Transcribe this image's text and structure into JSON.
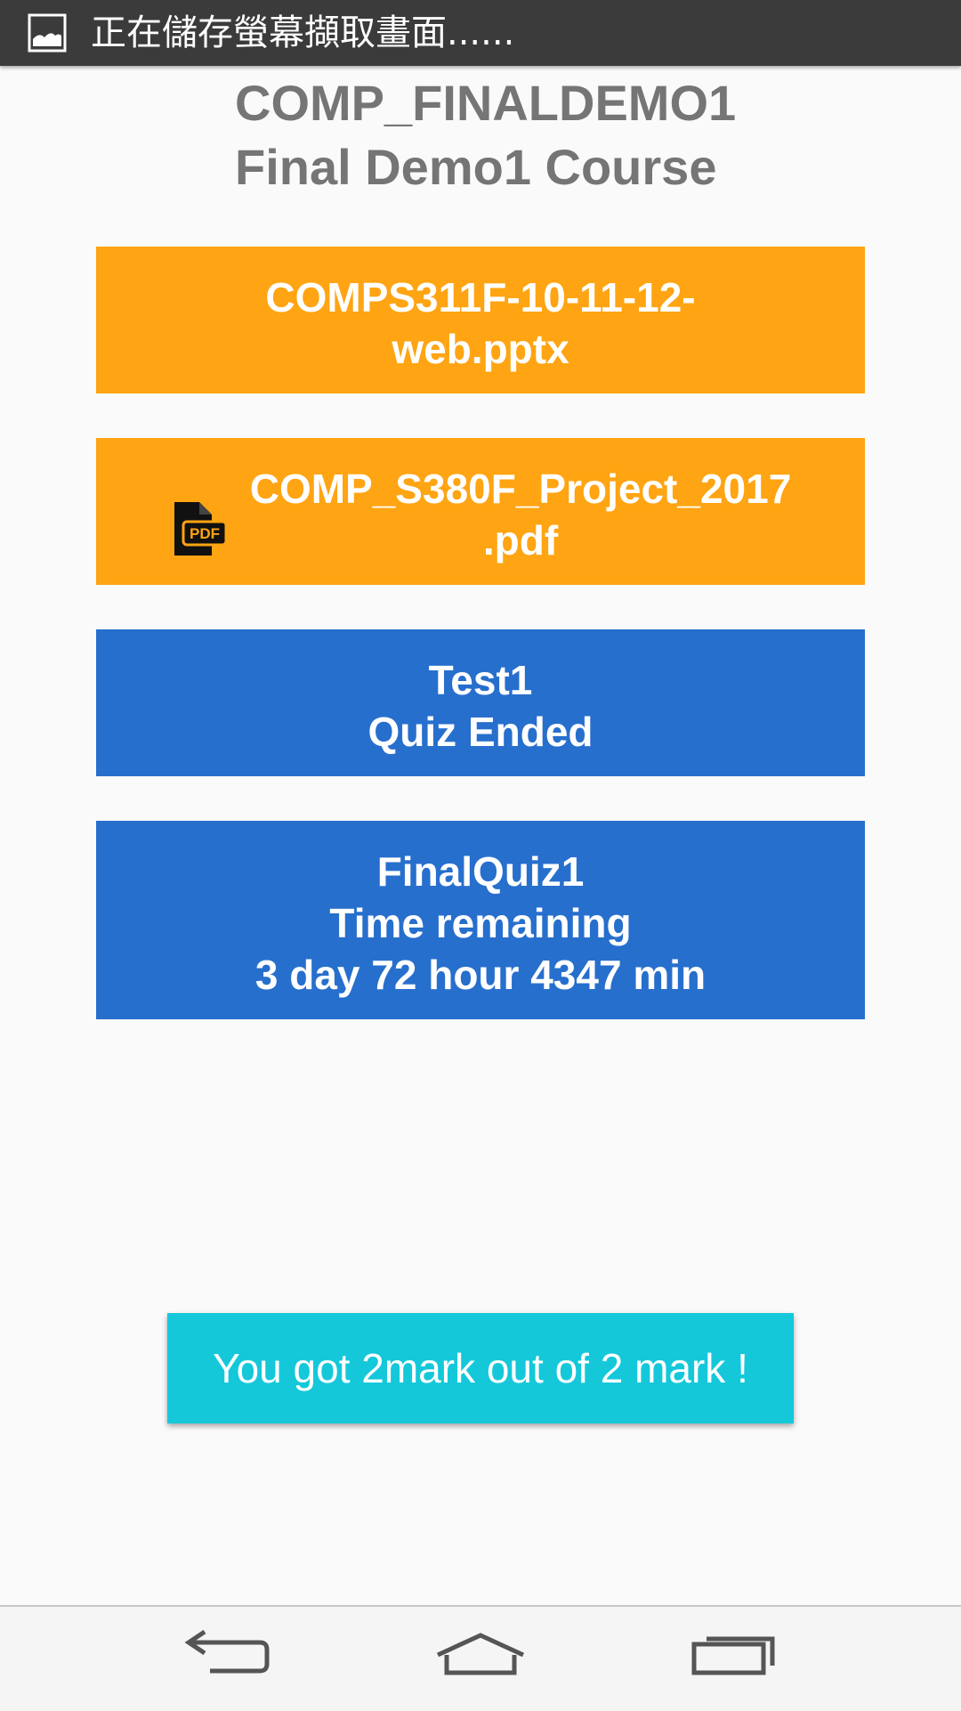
{
  "status_bar": {
    "notification_text": "正在儲存螢幕擷取畫面......"
  },
  "header": {
    "course_code": "COMP_FINALDEMO1",
    "course_name": "Final Demo1 Course"
  },
  "items": [
    {
      "kind": "file",
      "color": "#ffa412",
      "lines": [
        "COMPS311F-10-11-12-",
        "web.pptx"
      ]
    },
    {
      "kind": "file",
      "color": "#ffa412",
      "icon": "pdf-file-icon",
      "lines": [
        "COMP_S380F_Project_2017",
        ".pdf"
      ]
    },
    {
      "kind": "quiz",
      "color": "#276fcd",
      "lines": [
        "Test1",
        "Quiz Ended"
      ]
    },
    {
      "kind": "quiz",
      "color": "#276fcd",
      "lines": [
        "FinalQuiz1",
        "Time remaining",
        "3 day 72 hour 4347 min"
      ]
    }
  ],
  "toast": {
    "message": "You got 2mark out of 2 mark !",
    "color": "#14c8da"
  },
  "navigation": {
    "back": "back-icon",
    "home": "home-icon",
    "recents": "recents-icon"
  }
}
